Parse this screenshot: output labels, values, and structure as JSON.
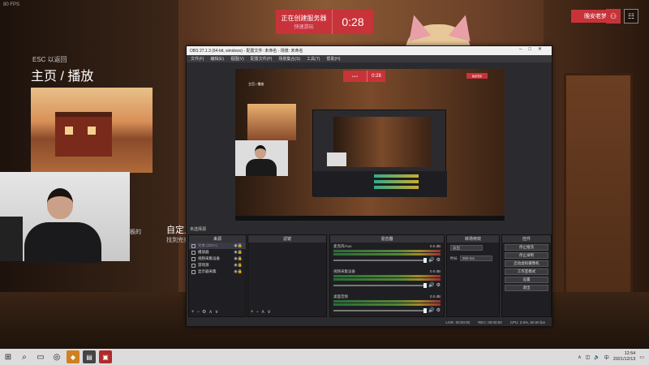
{
  "overlay": {
    "fps_label": "80 FPS",
    "esc_hint": "ESC 以返回",
    "page_title": "主页 / 播放",
    "custom_title": "自定义",
    "custom_sub": "找到完美",
    "left_snippet": "板的"
  },
  "server_banner": {
    "status": "正在创建服务器",
    "sub": "快速游玩",
    "countdown": "0:28"
  },
  "user": {
    "name": "晚安老梦"
  },
  "obs": {
    "window_title": "OBS 27.1.3 (64-bit, windows) - 配置文件: 未命名 - 场景: 未命名",
    "menu": [
      "文件(F)",
      "编辑(E)",
      "视图(V)",
      "配置文件(P)",
      "场景集合(S)",
      "工具(T)",
      "帮助(H)"
    ],
    "preview": {
      "page_title": "主页 / 播放",
      "countdown": "0:28",
      "user": "晚安老梦"
    },
    "scene_label": "未选择源",
    "docks": {
      "sources_label": "来源",
      "filters_label": "滤镜",
      "mixer_label": "混音器",
      "transitions_label": "转场特效",
      "controls_label": "控件"
    },
    "sources": [
      {
        "name": "文本 (GDI+)",
        "selected": true
      },
      {
        "name": "播放器",
        "selected": false
      },
      {
        "name": "视频采集设备",
        "selected": false
      },
      {
        "name": "游戏源",
        "selected": false
      },
      {
        "name": "显示器采集",
        "selected": false
      }
    ],
    "mixer": [
      {
        "name": "麦克风/Aux",
        "db": "0.0 dB"
      },
      {
        "name": "视频采集设备",
        "db": "0.0 dB"
      },
      {
        "name": "桌面音频",
        "db": "0.0 dB"
      }
    ],
    "transition": {
      "type": "淡出",
      "duration_label": "时长",
      "duration_value": "300 ms"
    },
    "controls": [
      "停止推流",
      "停止录制",
      "启动虚拟摄像机",
      "工作室模式",
      "设置",
      "退出"
    ],
    "status": {
      "live": "LIVE: 00:00:00",
      "rec": "REC: 00:00:00",
      "cpu": "CPU: 2.6%, 60.00 fps"
    }
  },
  "taskbar": {
    "time": "12:54",
    "date": "2021/12/13"
  },
  "colors": {
    "accent_red": "#c8333a",
    "obs_bg": "#2b2b2f",
    "taskbar_bg": "#dcdcdc"
  }
}
